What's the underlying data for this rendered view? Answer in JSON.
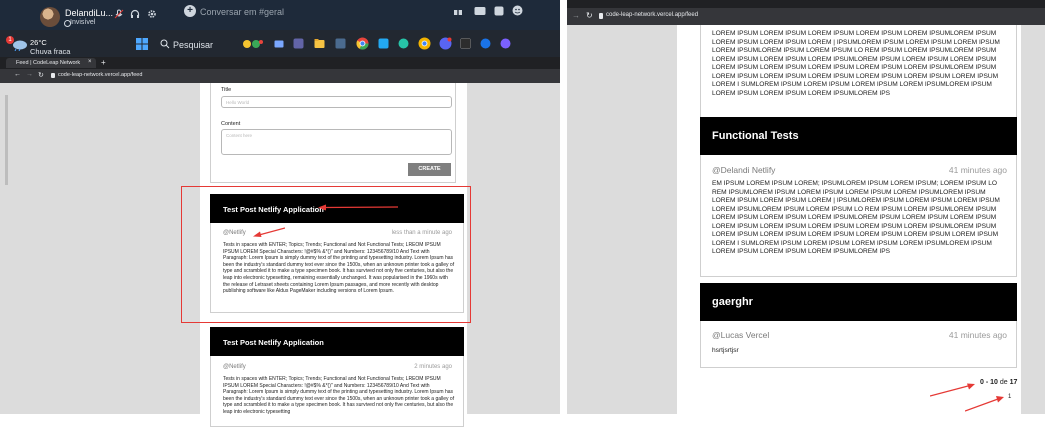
{
  "left": {
    "taskbar": {
      "profile_name": "DelandiLu...",
      "profile_status": "Invisível",
      "chat_placeholder": "Conversar em #geral",
      "weather_temp": "26°C",
      "weather_desc": "Chuva fraca",
      "search_label": "Pesquisar"
    },
    "browser": {
      "tab_title": "Feed | CodeLeap Network",
      "url": "code-leap-network.vercel.app/feed"
    },
    "form": {
      "title_label": "Title",
      "title_placeholder": "Hello World",
      "content_label": "Content",
      "content_placeholder": "Content here",
      "create_label": "CREATE"
    },
    "posts": [
      {
        "title": "Test Post Netlify Application",
        "author": "@Netlify",
        "time": "less than a minute ago",
        "body": "Tests in spaces with ENTER; Topics; Trends; Functional and Not Functional Tests; LREOM IPSUM IPSUM LOREM Special Characters: !@#$% &*()\" and Numbers: 123456789/10 And Text with Paragraph: Lorem Ipsum is simply dummy text of the printing and typesetting industry. Lorem Ipsum has been the industry's standard dummy text ever since the 1500s, when an unknown printer took a galley of type and scrambled it to make a type specimen book. It has survived not only five centuries, but also the leap into electronic typesetting, remaining essentially unchanged. It was popularised in the 1960s with the release of Letraset sheets containing Lorem Ipsum passages, and more recently with desktop publishing software like Aldus PageMaker including versions of Lorem Ipsum."
      },
      {
        "title": "Test Post Netlify Application",
        "author": "@Netlify",
        "time": "2 minutes ago",
        "body": "Tests in spaces with ENTER; Topics; Trends; Functional and Not Functional Tests; LREOM IPSUM IPSUM LOREM Special Characters: !@#$% &*()\" and Numbers: 123456789/10 And Text with Paragraph: Lorem Ipsum is simply dummy text of the printing and typesetting industry. Lorem Ipsum has been the industry's standard dummy text ever since the 1500s, when an unknown printer took a galley of type and scrambled it to make a type specimen book. It has survived not only five centuries, but also the leap into electronic typesetting"
      }
    ]
  },
  "right": {
    "browser": {
      "url": "code-leap-network.vercel.app/feed"
    },
    "top_body": "LOREM IPSUM LOREM IPSUM LOREM IPSUM LOREM IPSUM LOREM IPSUMLOREM IPSUM\nLOREM IPSUM LOREM IPSUM LOREM | IPSUMLOREM IPSUM LOREM IPSUM LOREM IPSUM\nLOREM IPSUMLOREM IPSUM LOREM IPSUM LO REM IPSUM LOREM IPSUMLOREM IPSUM\nLOREM IPSUM LOREM IPSUM LOREM IPSUMLOREM IPSUM LOREM IPSUM LOREM IPSUM\nLOREM IPSUM LOREM IPSUM LOREM IPSUM LOREM IPSUM LOREM IPSUMLOREM IPSUM\nLOREM IPSUM LOREM IPSUM LOREM IPSUM LOREM IPSUM LOREM IPSUM LOREM IPSUM\nLOREM I SUMLOREM IPSUM LOREM IPSUM LOREM IPSUM LOREM IPSUMLOREM IPSUM\nLOREM IPSUM LOREM IPSUM LOREM IPSUMLOREM IPS",
    "posts": [
      {
        "title": "Functional Tests",
        "author": "@Delandi Netlify",
        "time": "41 minutes ago",
        "body": "EM IPSUM LOREM IPSUM LOREM; IPSUMLOREM IPSUM LOREM IPSUM; LOREM IPSUM LO\nREM IPSUMLOREM IPSUM LOREM IPSUM LOREM IPSUM LOREM IPSUMLOREM IPSUM\nLOREM IPSUM LOREM IPSUM LOREM | IPSUMLOREM IPSUM LOREM IPSUM LOREM IPSUM\nLOREM IPSUMLOREM IPSUM LOREM IPSUM LO REM IPSUM LOREM IPSUMLOREM IPSUM\nLOREM IPSUM LOREM IPSUM LOREM IPSUMLOREM IPSUM LOREM IPSUM LOREM IPSUM\nLOREM IPSUM LOREM IPSUM LOREM IPSUM LOREM IPSUM LOREM IPSUMLOREM IPSUM\nLOREM IPSUM LOREM IPSUM LOREM IPSUM LOREM IPSUM LOREM IPSUM LOREM IPSUM\nLOREM I SUMLOREM IPSUM LOREM IPSUM LOREM IPSUM LOREM IPSUMLOREM IPSUM\nLOREM IPSUM LOREM IPSUM LOREM IPSUMLOREM IPS"
      },
      {
        "title": "gaerghr",
        "author": "@Lucas Vercel",
        "time": "41 minutes ago",
        "body": "hsrtjsrtjsr"
      }
    ],
    "pager": {
      "range": "0 - 10",
      "of_label": "de",
      "total": "17",
      "page": "1"
    }
  },
  "colors": {
    "header_black": "#000000",
    "highlight_red": "#e53935",
    "create_gray": "#7f7f7f",
    "page_gray": "#dcdcdc"
  }
}
